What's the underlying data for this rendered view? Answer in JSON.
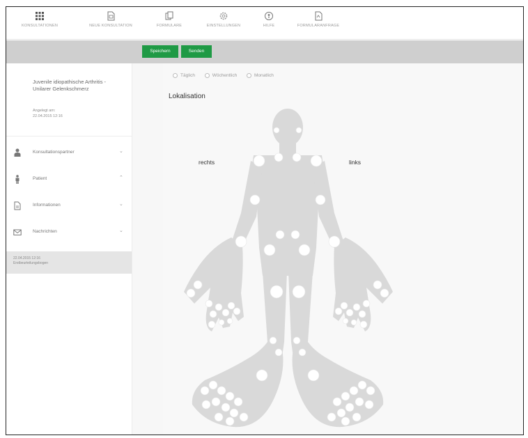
{
  "nav": [
    {
      "label": "KONSULTATIONEN",
      "icon": "grid-icon"
    },
    {
      "label": "NEUE KONSULTATION",
      "icon": "new-document-icon"
    },
    {
      "label": "FORMULARE",
      "icon": "forms-icon"
    },
    {
      "label": "EINSTELLUNGEN",
      "icon": "gear-icon"
    },
    {
      "label": "HILFE",
      "icon": "help-icon"
    },
    {
      "label": "FORMULARANFRAGE",
      "icon": "form-request-icon"
    }
  ],
  "toolbar": {
    "save_label": "Speichern",
    "send_label": "Senden"
  },
  "consultation": {
    "title": "Juvenile idiopathische Arthritis - Unilarer Gelenkschmerz",
    "created_label": "Angelegt am:",
    "created_date": "22.04.2015 12:16"
  },
  "sidebar_items": [
    {
      "label": "Konsultationspartner",
      "icon": "person-icon",
      "chevron": "⌄"
    },
    {
      "label": "Patient",
      "icon": "patient-icon",
      "chevron": "⌃"
    },
    {
      "label": "Informationen",
      "icon": "document-icon",
      "chevron": "⌄"
    },
    {
      "label": "Nachrichten",
      "icon": "envelope-icon",
      "chevron": "⌄"
    }
  ],
  "entry": {
    "date": "22.04.2015 12:16",
    "text": "Erstbeurteilungsbogen"
  },
  "frequency_options": [
    "Täglich",
    "Wöchentlich",
    "Monatlich"
  ],
  "section_title": "Lokalisation",
  "right_label": "rechts",
  "left_label": "links",
  "colors": {
    "accent": "#1f9a45",
    "toolbar_bg": "#cfcfcf",
    "body_fill": "#d9d9d9",
    "joint_fill": "#ffffff"
  }
}
